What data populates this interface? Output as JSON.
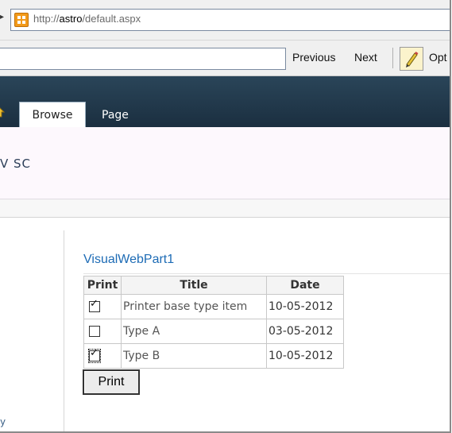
{
  "address_bar": {
    "url_prefix": "http://",
    "url_host": "astro",
    "url_path": "/default.aspx"
  },
  "find_bar": {
    "query": "",
    "previous_label": "Previous",
    "next_label": "Next",
    "options_label": "Opt"
  },
  "ribbon": {
    "tabs": [
      {
        "label": "Browse",
        "active": true
      },
      {
        "label": "Page",
        "active": false
      }
    ]
  },
  "site": {
    "title": "V SC"
  },
  "left_nav": {
    "stray_text": "y"
  },
  "web_part": {
    "title": "VisualWebPart1",
    "columns": [
      "Print",
      "Title",
      "Date"
    ],
    "rows": [
      {
        "checked": true,
        "title": "Printer base type item",
        "date": "10-05-2012"
      },
      {
        "checked": false,
        "title": "Type A",
        "date": "03-05-2012"
      },
      {
        "checked": true,
        "title": "Type B",
        "date": "10-05-2012",
        "focused": true
      }
    ],
    "print_button": "Print",
    "check_glyph": "✓"
  },
  "colors": {
    "ribbon": "#1b2f40",
    "link": "#1d6bb5",
    "title_area": "#fdf8fd"
  }
}
